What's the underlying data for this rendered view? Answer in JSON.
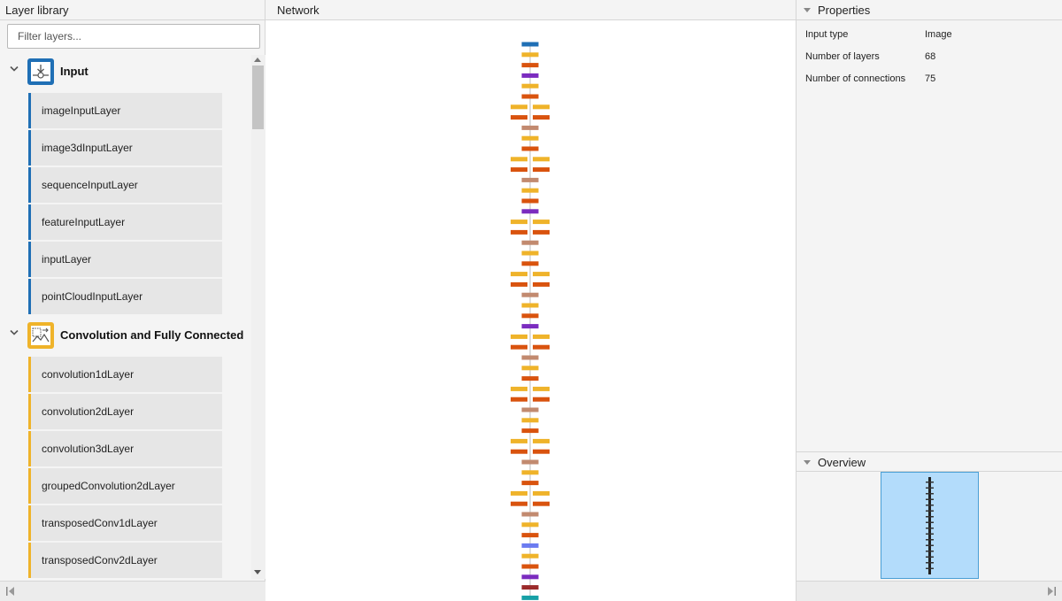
{
  "layer_library": {
    "title": "Layer library",
    "filter_placeholder": "Filter layers...",
    "categories": [
      {
        "label": "Input",
        "icon": "input-layer-icon",
        "color": "#1f6fb5",
        "items": [
          "imageInputLayer",
          "image3dInputLayer",
          "sequenceInputLayer",
          "featureInputLayer",
          "inputLayer",
          "pointCloudInputLayer"
        ]
      },
      {
        "label": "Convolution and Fully Connected",
        "icon": "convolution-layer-icon",
        "color": "#efb32a",
        "items": [
          "convolution1dLayer",
          "convolution2dLayer",
          "convolution3dLayer",
          "groupedConvolution2dLayer",
          "transposedConv1dLayer",
          "transposedConv2dLayer"
        ]
      }
    ]
  },
  "network": {
    "title": "Network"
  },
  "properties": {
    "title": "Properties",
    "rows": [
      {
        "key": "Input type",
        "value": "Image"
      },
      {
        "key": "Number of layers",
        "value": "68"
      },
      {
        "key": "Number of connections",
        "value": "75"
      }
    ]
  },
  "overview": {
    "title": "Overview"
  },
  "colors": {
    "input": "#1f6fb5",
    "conv": "#efb32a",
    "relu": "#d9530e",
    "norm": "#c28a6f",
    "pool": "#7b2cbf",
    "dropout": "#6b7bf0",
    "fc": "#9b2a2a",
    "output": "#17a0a6"
  }
}
